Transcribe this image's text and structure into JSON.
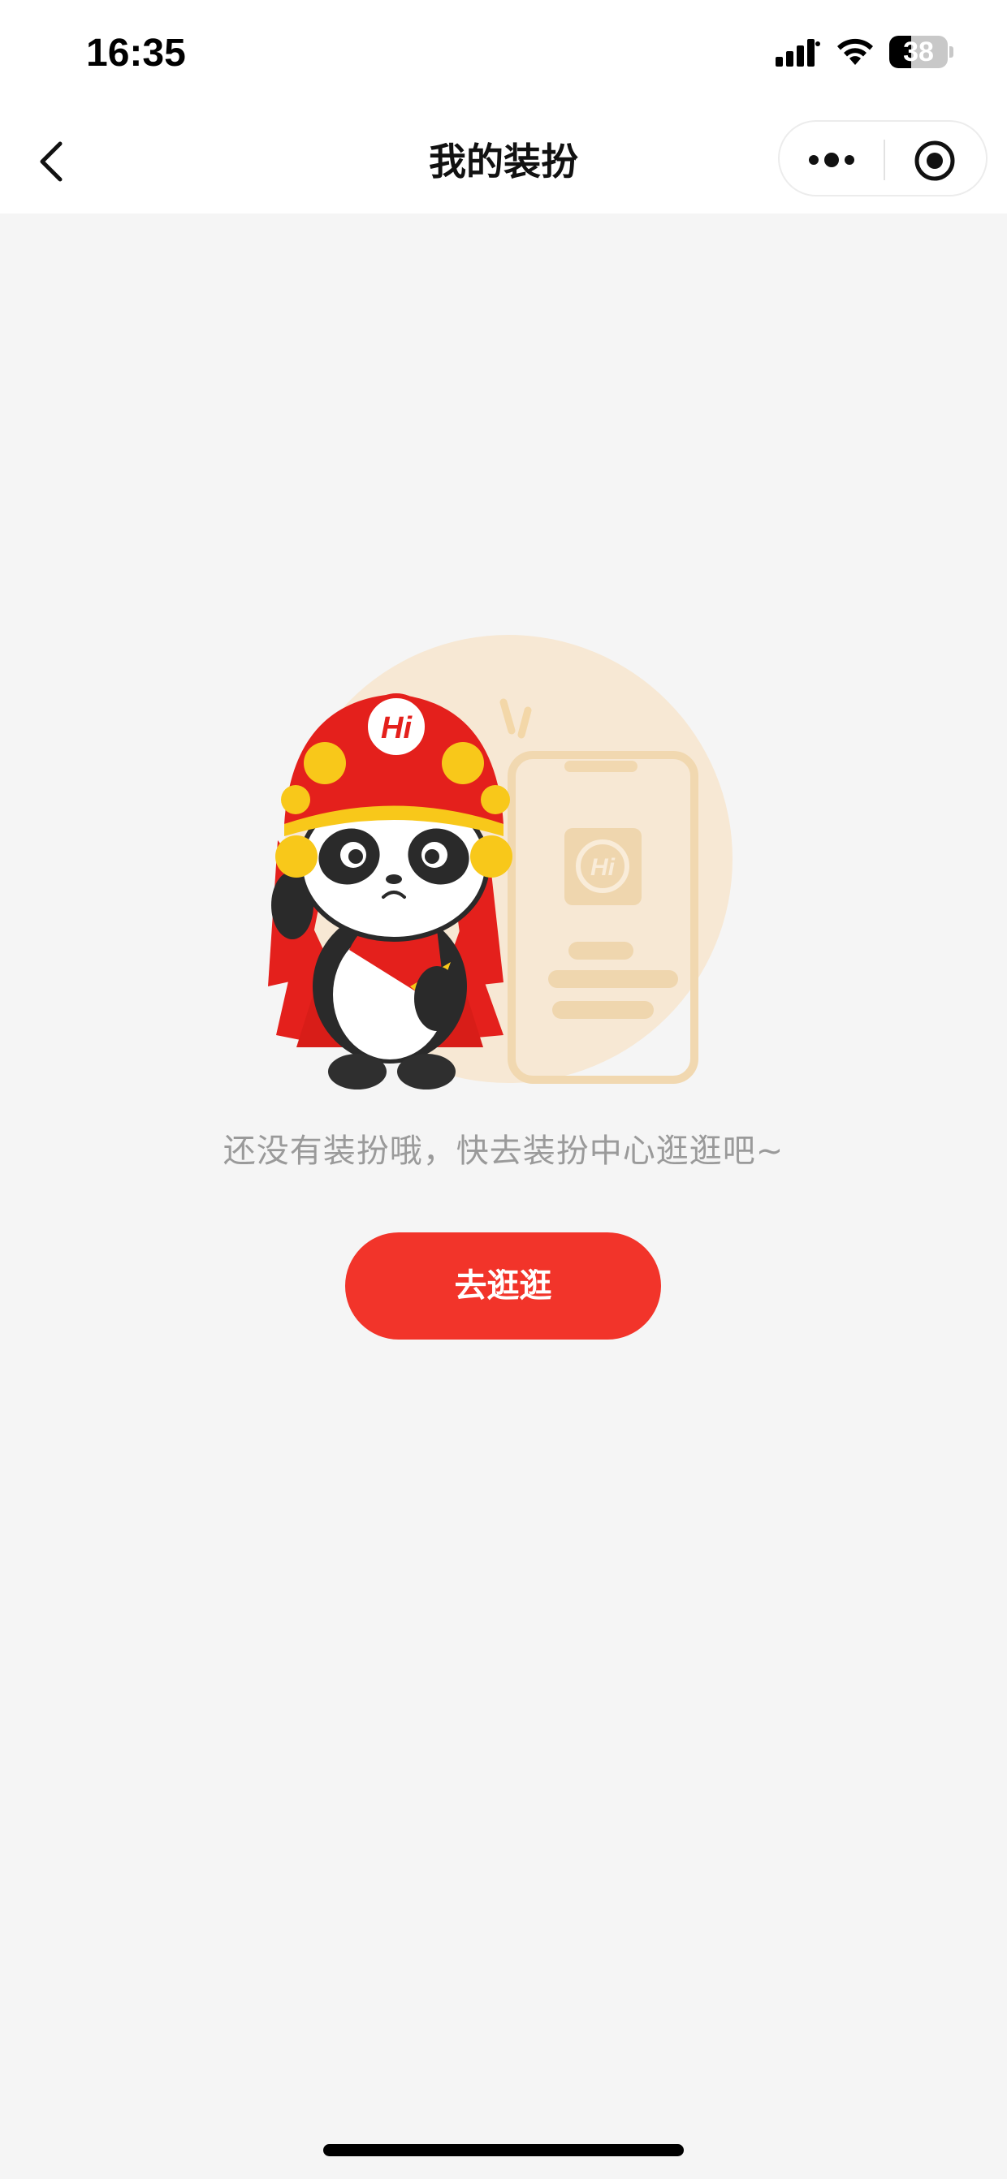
{
  "status_bar": {
    "time": "16:35",
    "battery_level": "38",
    "battery_fraction": 0.38,
    "icons": [
      "signal-icon",
      "wifi-icon",
      "battery-icon"
    ]
  },
  "nav": {
    "title": "我的装扮",
    "back_icon": "chevron-left-icon",
    "more_icon": "more-dots-icon",
    "close_icon": "miniprogram-close-icon"
  },
  "empty_state": {
    "illustration_badge": "Hi",
    "message": "还没有装扮哦，快去装扮中心逛逛吧~",
    "button_label": "去逛逛"
  },
  "colors": {
    "accent": "#f2342a",
    "background": "#f5f5f5",
    "message_text": "#9a9a9a"
  }
}
